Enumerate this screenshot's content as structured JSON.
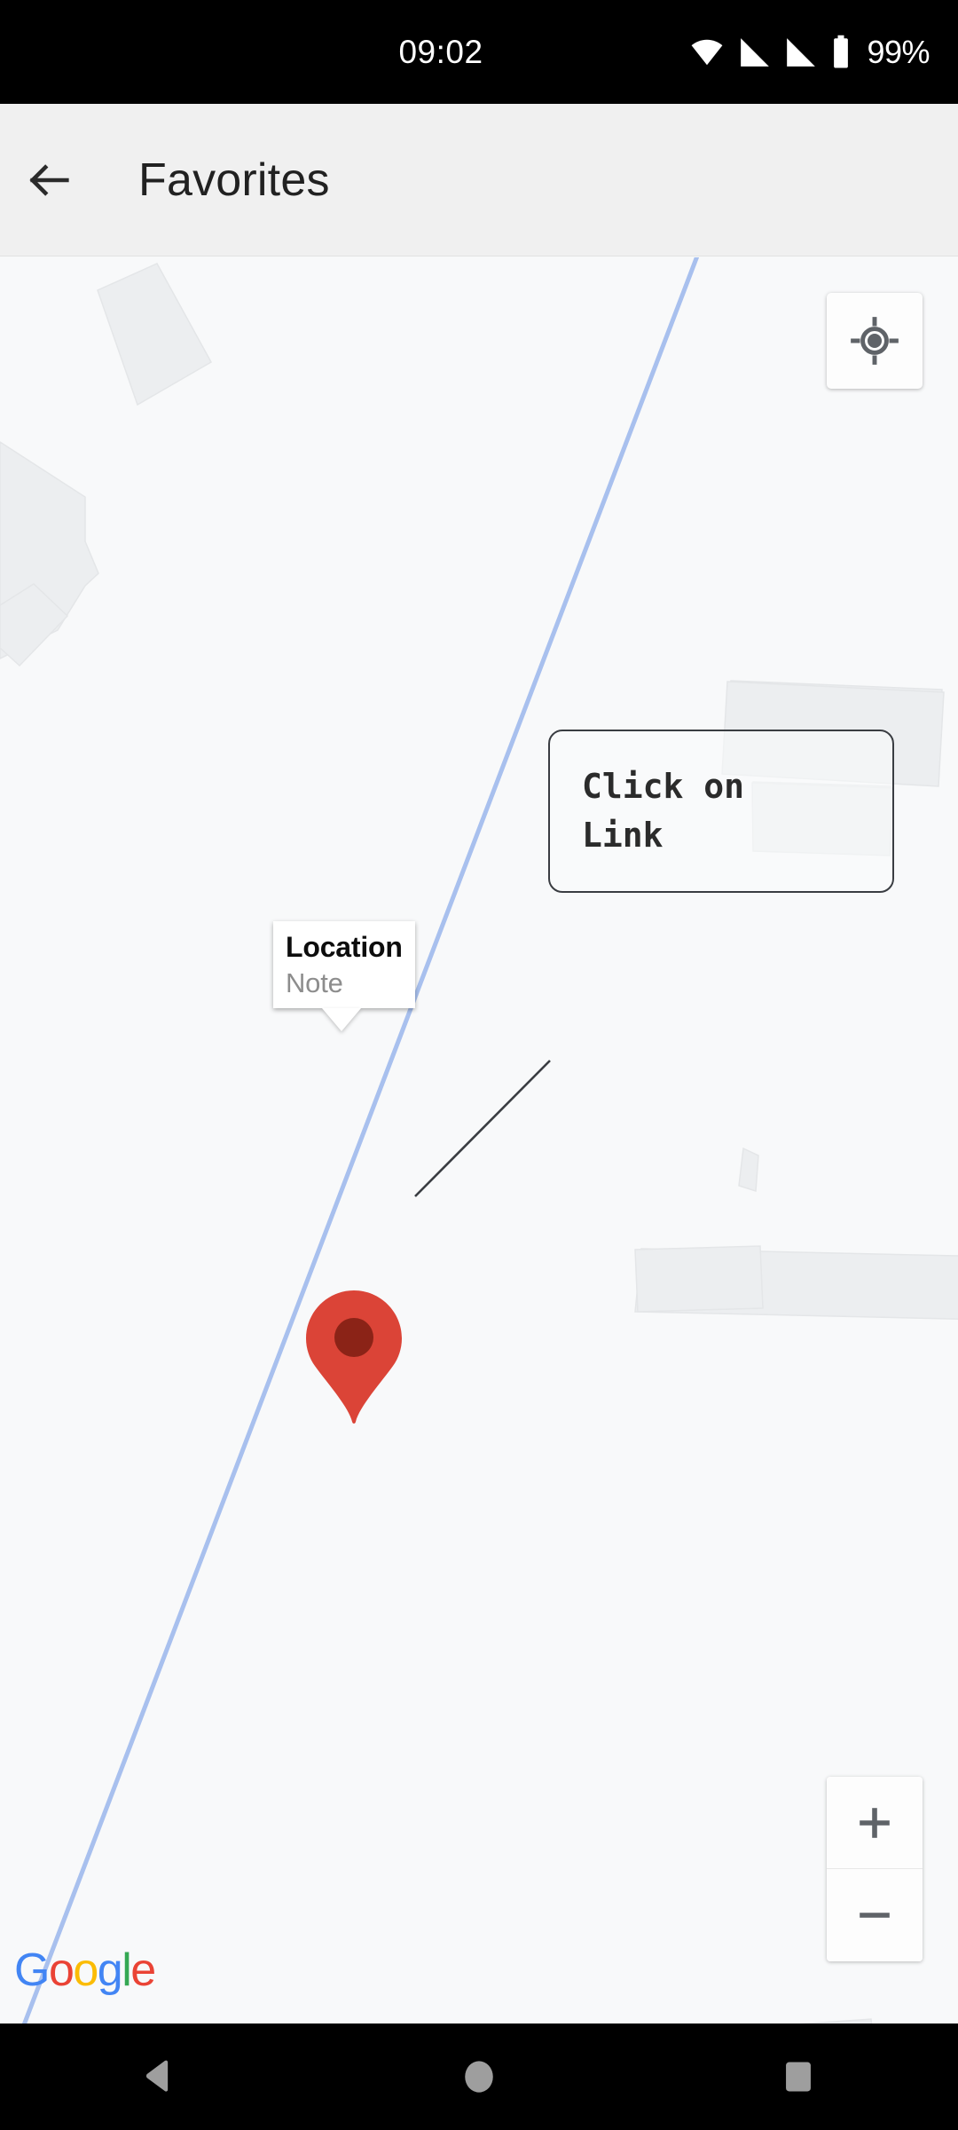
{
  "status_bar": {
    "time": "09:02",
    "battery_percent": "99%",
    "icons": [
      "wifi-icon",
      "signal-icon-1",
      "signal-icon-2",
      "battery-icon"
    ],
    "background": "#000000",
    "foreground": "#ffffff"
  },
  "app_bar": {
    "back_icon": "back-arrow-icon",
    "title": "Favorites",
    "background": "#f0f0f0",
    "text_color": "#212121"
  },
  "map": {
    "background": "#f8f9fa",
    "building_fill": "#eceef0",
    "building_stroke": "#e3e5e7",
    "road_color": "#a8c0ee",
    "attribution": "Google",
    "logo_letters": [
      {
        "char": "G",
        "color": "#4285F4"
      },
      {
        "char": "o",
        "color": "#EA4335"
      },
      {
        "char": "o",
        "color": "#FBBC05"
      },
      {
        "char": "g",
        "color": "#4285F4"
      },
      {
        "char": "l",
        "color": "#34A853"
      },
      {
        "char": "e",
        "color": "#EA4335"
      }
    ]
  },
  "controls": {
    "my_location": {
      "icon": "my-location-icon",
      "tooltip": "My Location"
    },
    "zoom_in": {
      "icon": "plus-icon",
      "label": "+"
    },
    "zoom_out": {
      "icon": "minus-icon",
      "label": "−"
    }
  },
  "marker": {
    "icon": "map-pin-icon",
    "color": "#DB4437",
    "inner_color": "#8B2317"
  },
  "info_window": {
    "title": "Location",
    "snippet": "Note",
    "title_color": "#0d0d0d",
    "snippet_color": "#8d8d8d",
    "background": "#ffffff"
  },
  "annotation": {
    "text": "Click on\nLink",
    "border_color": "#3a3d42",
    "text_color": "#2b2b2b"
  },
  "nav_bar": {
    "background": "#000000",
    "icon_color": "#9e9e9e",
    "buttons": [
      {
        "name": "back",
        "icon": "triangle-back-icon"
      },
      {
        "name": "home",
        "icon": "circle-home-icon"
      },
      {
        "name": "recents",
        "icon": "square-recents-icon"
      }
    ]
  }
}
